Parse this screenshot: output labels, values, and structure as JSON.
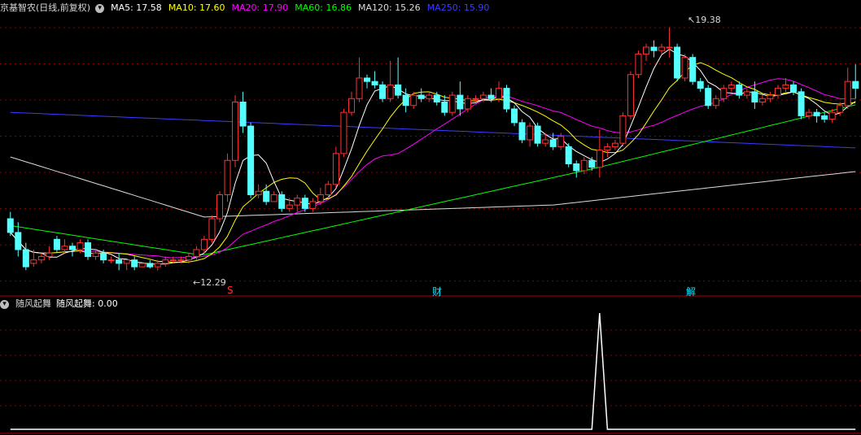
{
  "header": {
    "stock": "京基智农(日线,前复权)",
    "ma": [
      {
        "label": "MA5: 17.58",
        "color": "#ffffff"
      },
      {
        "label": "MA10: 17.60",
        "color": "#ffff00"
      },
      {
        "label": "MA20: 17.90",
        "color": "#ff00ff"
      },
      {
        "label": "MA60: 16.86",
        "color": "#00ff00"
      },
      {
        "label": "MA120: 15.26",
        "color": "#dcdcdc"
      },
      {
        "label": "MA250: 15.90",
        "color": "#3c3cff"
      }
    ]
  },
  "markers": [
    {
      "text": "S",
      "color": "#ff3030"
    },
    {
      "text": "财",
      "color": "#00e5ff"
    },
    {
      "text": "解",
      "color": "#00e5ff"
    }
  ],
  "annotations": {
    "high": "19.38",
    "low": "12.29"
  },
  "indicator": {
    "name": "随风起舞",
    "value_label": "随风起舞: 0.00"
  },
  "colors": {
    "up": "#ff3232",
    "down": "#54ffff",
    "ma5": "#ffffff",
    "ma10": "#ffff00",
    "ma20": "#ff00ff",
    "ma60": "#00ff00",
    "ma120": "#dcdcdc",
    "ma250": "#3c3cff",
    "grid": "#8b0000",
    "separator": "#b00000"
  },
  "chart_data": {
    "type": "candlestick",
    "candles": [
      [
        13.8,
        13.4,
        14.0,
        13.3
      ],
      [
        13.4,
        12.9,
        13.7,
        12.7
      ],
      [
        12.9,
        12.4,
        13.1,
        12.3
      ],
      [
        12.5,
        12.6,
        12.9,
        12.4
      ],
      [
        12.6,
        12.7,
        12.8,
        12.5
      ],
      [
        12.7,
        12.8,
        13.0,
        12.6
      ],
      [
        13.2,
        12.9,
        13.3,
        12.8
      ],
      [
        12.9,
        13.0,
        13.2,
        12.8
      ],
      [
        13.0,
        12.9,
        13.1,
        12.7
      ],
      [
        12.9,
        13.1,
        13.2,
        12.8
      ],
      [
        13.1,
        12.7,
        13.2,
        12.6
      ],
      [
        12.7,
        12.8,
        12.9,
        12.6
      ],
      [
        12.8,
        12.6,
        12.9,
        12.5
      ],
      [
        12.6,
        12.6,
        12.7,
        12.5
      ],
      [
        12.6,
        12.5,
        12.8,
        12.3
      ],
      [
        12.5,
        12.6,
        12.6,
        12.3
      ],
      [
        12.6,
        12.4,
        12.7,
        12.3
      ],
      [
        12.4,
        12.5,
        12.5,
        12.4
      ],
      [
        12.5,
        12.4,
        12.6,
        12.35
      ],
      [
        12.4,
        12.5,
        12.6,
        12.29
      ],
      [
        12.5,
        12.6,
        12.7,
        12.4
      ],
      [
        12.6,
        12.6,
        12.7,
        12.5
      ],
      [
        12.6,
        12.6,
        12.7,
        12.5
      ],
      [
        12.6,
        12.7,
        12.8,
        12.5
      ],
      [
        12.7,
        12.9,
        13.0,
        12.6
      ],
      [
        12.9,
        13.2,
        13.3,
        12.8
      ],
      [
        13.2,
        13.8,
        13.9,
        13.1
      ],
      [
        13.8,
        14.5,
        14.6,
        13.7
      ],
      [
        14.5,
        15.5,
        15.7,
        14.3
      ],
      [
        15.5,
        17.2,
        17.4,
        15.3
      ],
      [
        17.2,
        16.5,
        17.5,
        16.3
      ],
      [
        16.5,
        14.5,
        16.6,
        14.4
      ],
      [
        14.5,
        14.6,
        14.8,
        14.4
      ],
      [
        14.6,
        14.3,
        14.8,
        14.2
      ],
      [
        14.3,
        14.5,
        14.6,
        14.3
      ],
      [
        14.5,
        14.1,
        14.6,
        14.0
      ],
      [
        14.1,
        14.2,
        14.4,
        14.0
      ],
      [
        14.2,
        14.4,
        14.5,
        14.0
      ],
      [
        14.4,
        14.1,
        14.5,
        14.0
      ],
      [
        14.1,
        14.3,
        14.4,
        14.0
      ],
      [
        14.3,
        14.5,
        14.7,
        14.2
      ],
      [
        14.5,
        14.8,
        14.9,
        14.4
      ],
      [
        14.8,
        15.7,
        15.9,
        14.7
      ],
      [
        15.7,
        16.9,
        17.0,
        15.6
      ],
      [
        16.9,
        17.3,
        17.5,
        16.8
      ],
      [
        17.3,
        17.9,
        18.5,
        17.2
      ],
      [
        17.9,
        17.8,
        18.0,
        17.6
      ],
      [
        17.8,
        17.7,
        18.1,
        17.6
      ],
      [
        17.7,
        17.3,
        17.8,
        17.2
      ],
      [
        17.3,
        17.7,
        18.4,
        17.2
      ],
      [
        17.7,
        17.4,
        18.5,
        17.3
      ],
      [
        17.4,
        17.1,
        17.6,
        16.9
      ],
      [
        17.1,
        17.4,
        17.5,
        17.0
      ],
      [
        17.4,
        17.3,
        17.6,
        17.2
      ],
      [
        17.3,
        17.4,
        17.5,
        17.2
      ],
      [
        17.4,
        17.2,
        17.5,
        17.1
      ],
      [
        17.2,
        16.9,
        17.4,
        16.8
      ],
      [
        16.9,
        17.4,
        17.5,
        16.8
      ],
      [
        17.4,
        17.0,
        17.8,
        16.8
      ],
      [
        17.0,
        17.3,
        17.4,
        16.9
      ],
      [
        17.3,
        17.3,
        17.4,
        17.2
      ],
      [
        17.3,
        17.4,
        17.5,
        17.2
      ],
      [
        17.4,
        17.3,
        17.6,
        17.2
      ],
      [
        17.3,
        17.6,
        17.8,
        17.2
      ],
      [
        17.6,
        17.0,
        17.7,
        16.9
      ],
      [
        17.0,
        16.6,
        17.1,
        16.5
      ],
      [
        16.6,
        16.1,
        16.7,
        16.0
      ],
      [
        16.1,
        16.5,
        16.6,
        15.9
      ],
      [
        16.5,
        16.0,
        16.6,
        15.9
      ],
      [
        16.0,
        16.1,
        16.3,
        15.9
      ],
      [
        16.1,
        15.9,
        16.3,
        15.8
      ],
      [
        15.9,
        16.2,
        16.3,
        15.8
      ],
      [
        15.9,
        15.4,
        16.0,
        15.3
      ],
      [
        15.4,
        15.2,
        15.5,
        15.0
      ],
      [
        15.2,
        15.5,
        15.6,
        15.1
      ],
      [
        15.5,
        15.3,
        15.6,
        15.2
      ],
      [
        15.3,
        15.8,
        16.4,
        15.0
      ],
      [
        15.8,
        15.9,
        16.0,
        15.6
      ],
      [
        15.9,
        16.0,
        16.1,
        15.8
      ],
      [
        16.0,
        16.8,
        16.9,
        15.9
      ],
      [
        16.8,
        18.0,
        18.1,
        16.7
      ],
      [
        18.0,
        18.6,
        18.7,
        17.9
      ],
      [
        18.6,
        18.8,
        18.9,
        18.4
      ],
      [
        18.8,
        18.7,
        19.0,
        18.5
      ],
      [
        18.7,
        18.8,
        18.9,
        18.6
      ],
      [
        18.8,
        18.8,
        19.38,
        18.5
      ],
      [
        18.8,
        17.9,
        18.9,
        17.8
      ],
      [
        17.9,
        18.5,
        18.6,
        17.8
      ],
      [
        18.5,
        17.8,
        18.6,
        17.7
      ],
      [
        17.8,
        17.6,
        17.9,
        17.5
      ],
      [
        17.6,
        17.1,
        17.7,
        17.0
      ],
      [
        17.1,
        17.3,
        17.4,
        17.0
      ],
      [
        17.3,
        17.6,
        17.7,
        17.2
      ],
      [
        17.6,
        17.7,
        17.8,
        17.5
      ],
      [
        17.7,
        17.4,
        17.8,
        17.3
      ],
      [
        17.4,
        17.5,
        17.6,
        17.3
      ],
      [
        17.5,
        17.2,
        17.8,
        17.0
      ],
      [
        17.2,
        17.3,
        17.4,
        17.1
      ],
      [
        17.3,
        17.4,
        17.5,
        17.2
      ],
      [
        17.4,
        17.6,
        17.7,
        17.3
      ],
      [
        17.6,
        17.7,
        17.9,
        17.5
      ],
      [
        17.7,
        17.5,
        17.8,
        17.4
      ],
      [
        17.5,
        16.8,
        17.6,
        16.7
      ],
      [
        16.8,
        16.9,
        17.0,
        16.7
      ],
      [
        16.9,
        16.8,
        17.0,
        16.6
      ],
      [
        16.8,
        16.7,
        16.9,
        16.6
      ],
      [
        16.7,
        16.9,
        17.0,
        16.6
      ],
      [
        16.9,
        17.1,
        17.2,
        16.8
      ],
      [
        17.1,
        17.8,
        18.2,
        17.0
      ],
      [
        17.8,
        17.6,
        18.3,
        17.3
      ]
    ],
    "y_range": [
      12.0,
      19.7
    ],
    "indicator_values": [
      0,
      0,
      0,
      0,
      0,
      0,
      0,
      0,
      0,
      0,
      0,
      0,
      0,
      0,
      0,
      0,
      0,
      0,
      0,
      0,
      0,
      0,
      0,
      0,
      0,
      0,
      0,
      0,
      0,
      0,
      0,
      0,
      0,
      0,
      0,
      0,
      0,
      0,
      0,
      0,
      0,
      0,
      0,
      0,
      0,
      0,
      0,
      0,
      0,
      0,
      0,
      0,
      0,
      0,
      0,
      0,
      0,
      0,
      0,
      0,
      0,
      0,
      0,
      0,
      0,
      0,
      0,
      0,
      0,
      0,
      0,
      0,
      0,
      0,
      0,
      0,
      0,
      0,
      0,
      0,
      0,
      0,
      0,
      0,
      0,
      0,
      0,
      0,
      0,
      0,
      0,
      0,
      0,
      0,
      0,
      0,
      0,
      0,
      0,
      0,
      0,
      0,
      0,
      0,
      0,
      0,
      0,
      0,
      0,
      0
    ],
    "indicator_spike": {
      "index": 76,
      "value": 1
    }
  }
}
